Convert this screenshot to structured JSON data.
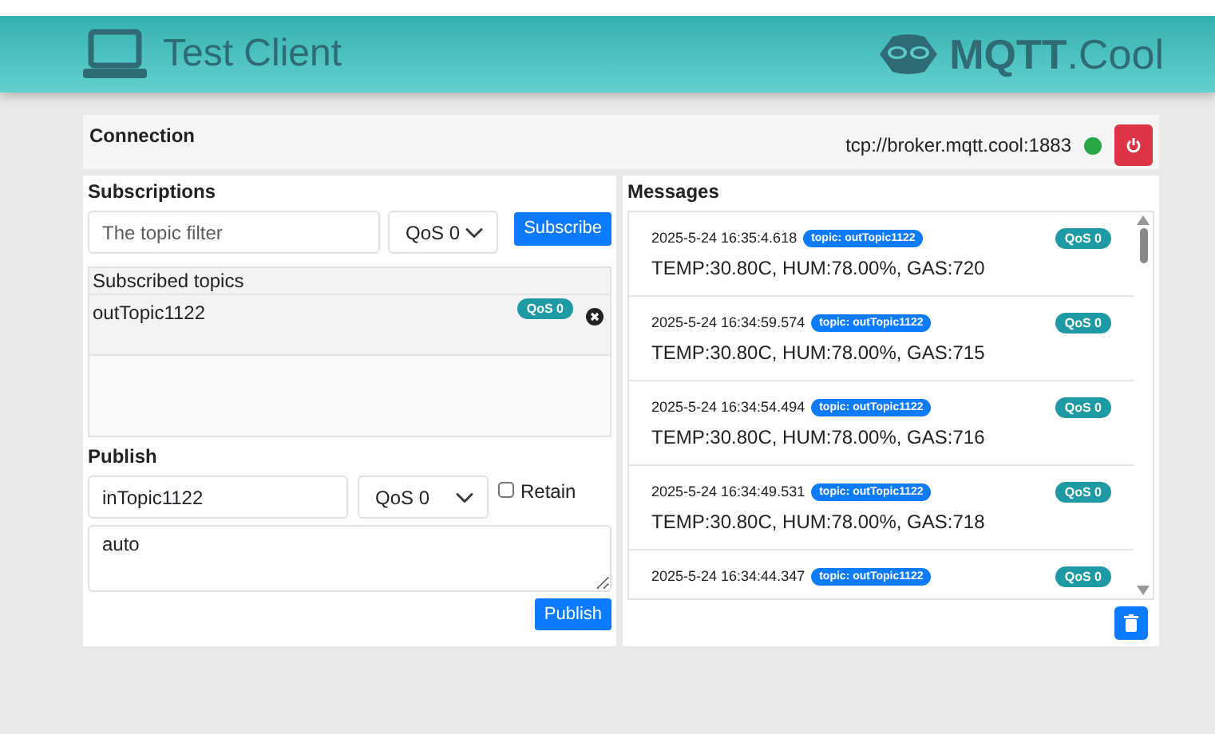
{
  "header": {
    "title": "Test Client",
    "logo": "**MQTT**.Cool"
  },
  "connection": {
    "title": "Connection",
    "url": "tcp://broker.mqtt.cool:1883",
    "connected": true
  },
  "subscriptions": {
    "title": "Subscriptions",
    "topic_placeholder": "The topic filter",
    "qos": "QoS 0",
    "button": "Subscribe",
    "list_title": "Subscribed topics",
    "topics": [
      {
        "name": "outTopic1122",
        "qos": "QoS 0"
      }
    ]
  },
  "publish": {
    "title": "Publish",
    "topic": "inTopic1122",
    "qos": "QoS 0",
    "retain_label": "Retain",
    "retain": false,
    "payload": "auto",
    "button": "Publish"
  },
  "messages": {
    "title": "Messages",
    "items": [
      {
        "time": "2025-5-24 16:35:4.618",
        "topic": "topic: outTopic1122",
        "qos": "QoS 0",
        "payload": "TEMP:30.80C, HUM:78.00%, GAS:720"
      },
      {
        "time": "2025-5-24 16:34:59.574",
        "topic": "topic: outTopic1122",
        "qos": "QoS 0",
        "payload": "TEMP:30.80C, HUM:78.00%, GAS:715"
      },
      {
        "time": "2025-5-24 16:34:54.494",
        "topic": "topic: outTopic1122",
        "qos": "QoS 0",
        "payload": "TEMP:30.80C, HUM:78.00%, GAS:716"
      },
      {
        "time": "2025-5-24 16:34:49.531",
        "topic": "topic: outTopic1122",
        "qos": "QoS 0",
        "payload": "TEMP:30.80C, HUM:78.00%, GAS:718"
      },
      {
        "time": "2025-5-24 16:34:44.347",
        "topic": "topic: outTopic1122",
        "qos": "QoS 0"
      }
    ]
  }
}
